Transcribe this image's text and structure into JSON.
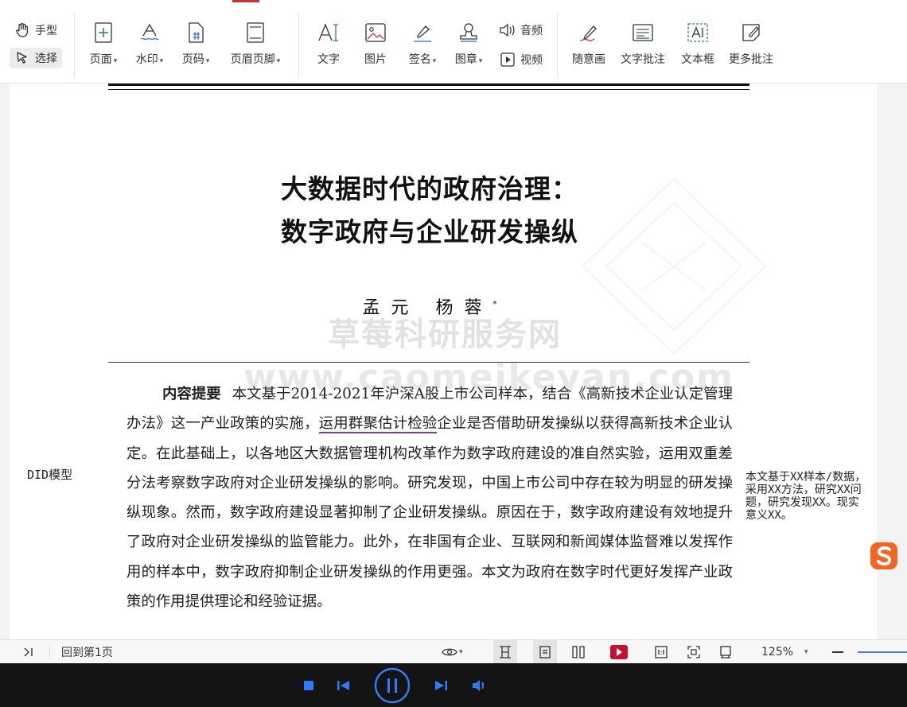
{
  "toolbar": {
    "hand": "手型",
    "select": "选择",
    "page": "页面",
    "watermark": "水印",
    "page_number": "页码",
    "header_footer": "页眉页脚",
    "text": "文字",
    "image": "图片",
    "sign": "签名",
    "stamp": "图章",
    "audio": "音频",
    "video": "视频",
    "freehand": "随意画",
    "text_comment": "文字批注",
    "textbox": "文本框",
    "more_comments": "更多批注"
  },
  "document": {
    "title_line1": "大数据时代的政府治理：",
    "title_line2": "数字政府与企业研发操纵",
    "author1": "孟元",
    "author2": "杨蓉",
    "author_mark": "*",
    "abstract_heading": "内容提要",
    "abstract_part1": "本文基于2014-2021年沪深A股上市公司样本，结合《高新技术企业认定管理办法》这一产业政策的实施，",
    "abstract_highlight": "运用群聚估计检验",
    "abstract_part2": "企业是否借助研发操纵以获得高新技术企业认定。在此基础上，以各地区大数据管理机构改革作为数字政府建设的准自然实验，运用双重差分法考察数字政府对企业研发操纵的影响。研究发现，中国上市公司中存在较为明显的研发操纵现象。然而，数字政府建设显著抑制了企业研发操纵。原因在于，数字政府建设有效地提升了政府对企业研发操纵的监管能力。此外，在非国有企业、互联网和新闻媒体监督难以发挥作用的样本中，数字政府抑制企业研发操纵的作用更强。本文为政府在数字时代更好发挥产业政策的作用提供理论和经验证据。",
    "watermark_cn": "草莓科研服务网",
    "watermark_url": "www.caomeikeyan.com"
  },
  "annotations": {
    "left_note": "DID模型",
    "right_note": "本文基于XX样本/数据，采用XX方法，研究XX问题，研究发现XX。现实意义XX。"
  },
  "status_bar": {
    "back_to_first": "回到第1页",
    "zoom": "125%"
  },
  "colors": {
    "highlight_underline": "#7b3fa0",
    "play_red": "#c8102e",
    "player_blue": "#2f7df6",
    "ime_orange": "#f26522"
  }
}
